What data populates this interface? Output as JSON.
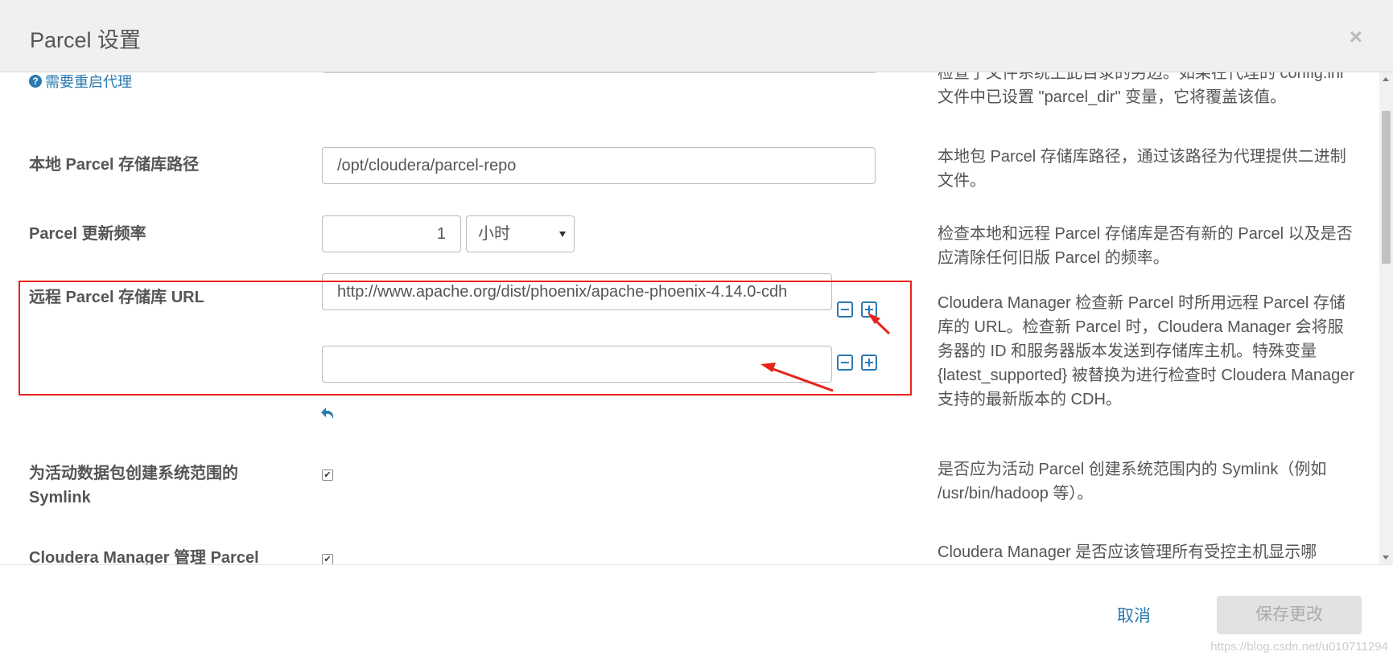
{
  "header": {
    "title": "Parcel 设置",
    "close_symbol": "×"
  },
  "help_link": {
    "icon": "?",
    "label": "需要重启代理"
  },
  "top_desc": "检查了文件系统上此目录的另边。如果在代理的 config.ini 文件中已设置 \"parcel_dir\" 变量，它将覆盖该值。",
  "local_repo": {
    "label": "本地 Parcel 存储库路径",
    "value": "/opt/cloudera/parcel-repo",
    "desc": "本地包 Parcel 存储库路径，通过该路径为代理提供二进制文件。"
  },
  "update_freq": {
    "label": "Parcel 更新频率",
    "value": "1",
    "unit": "小时",
    "desc": "检查本地和远程 Parcel 存储库是否有新的 Parcel 以及是否应清除任何旧版 Parcel 的频率。"
  },
  "remote_repo": {
    "label": "远程 Parcel 存储库 URL",
    "urls": [
      "http://www.apache.org/dist/phoenix/apache-phoenix-4.14.0-cdh",
      ""
    ],
    "desc": "Cloudera Manager 检查新 Parcel 时所用远程 Parcel 存储库的 URL。检查新 Parcel 时，Cloudera Manager 会将服务器的 ID 和服务器版本发送到存储库主机。特殊变量 {latest_supported} 被替换为进行检查时 Cloudera Manager 支持的最新版本的 CDH。"
  },
  "symlink": {
    "label": "为活动数据包创建系统范围的 Symlink",
    "checked": true,
    "desc": "是否应为活动 Parcel 创建系统范围内的 Symlink（例如 /usr/bin/hadoop 等）。"
  },
  "manage": {
    "label": "Cloudera Manager 管理 Parcel",
    "checked": true,
    "desc": "Cloudera Manager 是否应该管理所有受控主机显示哪"
  },
  "footer": {
    "cancel_label": "取消",
    "save_label": "保存更改"
  },
  "watermark": "https://blog.csdn.net/u010711294",
  "colors": {
    "accent": "#2a7ab0",
    "highlight": "#e8231c"
  },
  "icons": [
    "close-icon",
    "help-icon",
    "minus-icon",
    "plus-icon",
    "undo-icon",
    "checkbox-icon",
    "dropdown-arrow-icon"
  ]
}
